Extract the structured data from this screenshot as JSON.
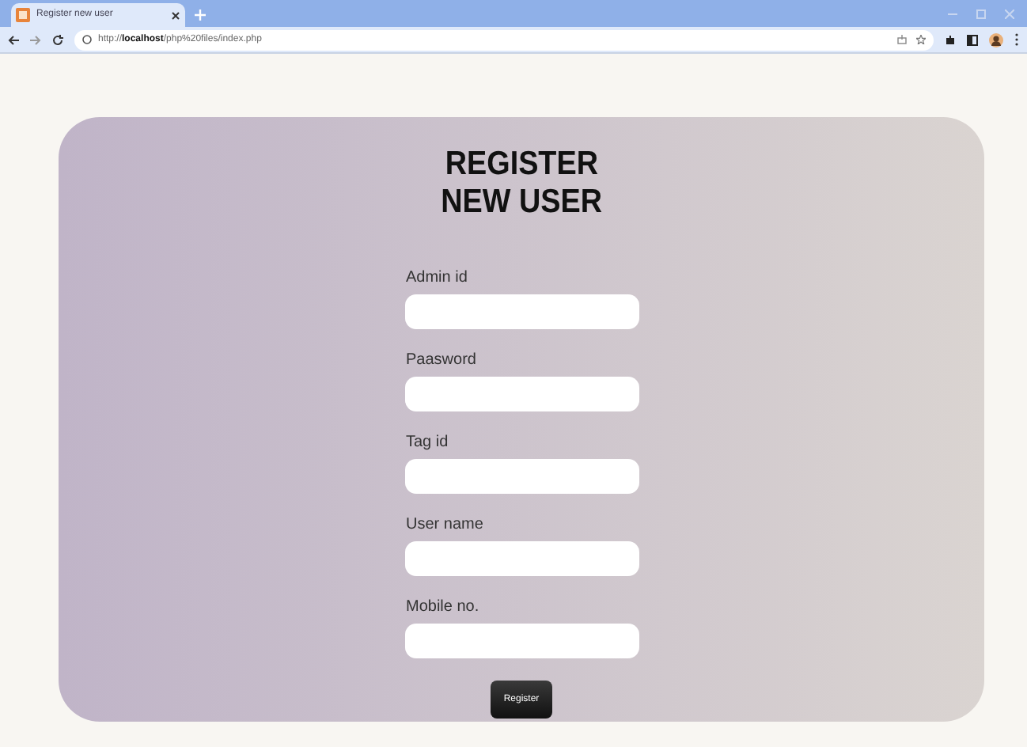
{
  "browser": {
    "tab_title": "Register new user",
    "url_prefix": "http://",
    "url_host": "localhost",
    "url_path": "/php%20files/index.php"
  },
  "form": {
    "title_lines": [
      "REGISTER",
      "NEW USER"
    ],
    "fields": [
      {
        "label": "Admin id"
      },
      {
        "label": "Paasword"
      },
      {
        "label": "Tag id"
      },
      {
        "label": "User name"
      },
      {
        "label": "Mobile no."
      }
    ],
    "submit": "Register"
  }
}
